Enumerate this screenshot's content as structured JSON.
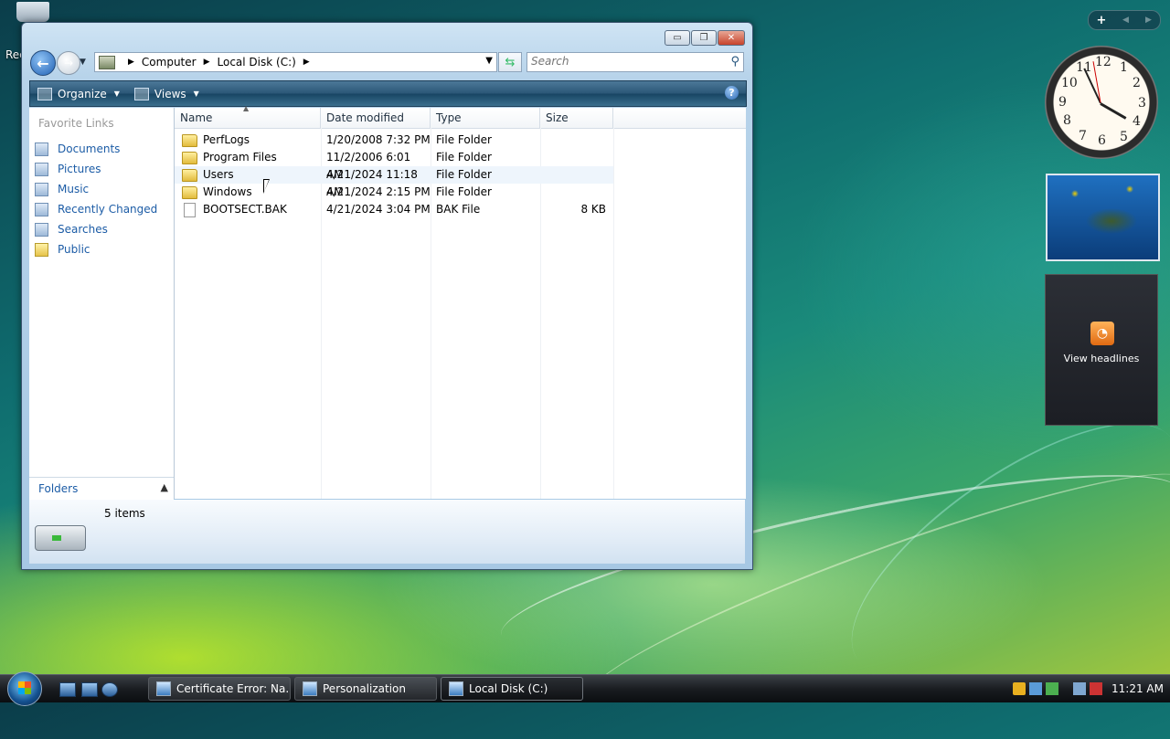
{
  "desktop": {
    "recycle_bin_label": "Rec"
  },
  "window": {
    "buttons": {
      "minimize": "▭",
      "maximize": "❐",
      "close": "✕"
    },
    "address": {
      "crumbs": [
        "Computer",
        "Local Disk (C:)"
      ]
    },
    "search": {
      "placeholder": "Search"
    },
    "toolbar": {
      "organize": "Organize",
      "views": "Views",
      "help": "?"
    },
    "nav": {
      "title": "Favorite Links",
      "items": [
        {
          "label": "Documents",
          "icon": "documents-icon"
        },
        {
          "label": "Pictures",
          "icon": "pictures-icon"
        },
        {
          "label": "Music",
          "icon": "music-icon"
        },
        {
          "label": "Recently Changed",
          "icon": "recent-icon"
        },
        {
          "label": "Searches",
          "icon": "searches-icon"
        },
        {
          "label": "Public",
          "icon": "folder-icon"
        }
      ],
      "folders_label": "Folders"
    },
    "columns": {
      "name": "Name",
      "date": "Date modified",
      "type": "Type",
      "size": "Size"
    },
    "files": [
      {
        "name": "PerfLogs",
        "date": "1/20/2008 7:32 PM",
        "type": "File Folder",
        "size": "",
        "icon": "folder-icon"
      },
      {
        "name": "Program Files",
        "date": "11/2/2006 6:01 AM",
        "type": "File Folder",
        "size": "",
        "icon": "folder-icon"
      },
      {
        "name": "Users",
        "date": "4/21/2024 11:18 AM",
        "type": "File Folder",
        "size": "",
        "icon": "folder-icon"
      },
      {
        "name": "Windows",
        "date": "4/21/2024 2:15 PM",
        "type": "File Folder",
        "size": "",
        "icon": "folder-icon"
      },
      {
        "name": "BOOTSECT.BAK",
        "date": "4/21/2024 3:04 PM",
        "type": "BAK File",
        "size": "8 KB",
        "icon": "file-icon"
      }
    ],
    "status": {
      "item_count": "5 items"
    }
  },
  "gadgets": {
    "add": "+",
    "feed_label": "View headlines"
  },
  "taskbar": {
    "tasks": [
      {
        "label": "Certificate Error: Na...",
        "icon": "ie-icon"
      },
      {
        "label": "Personalization",
        "icon": "personalization-icon"
      },
      {
        "label": "Local Disk (C:)",
        "icon": "explorer-icon"
      }
    ],
    "time": "11:21 AM"
  }
}
